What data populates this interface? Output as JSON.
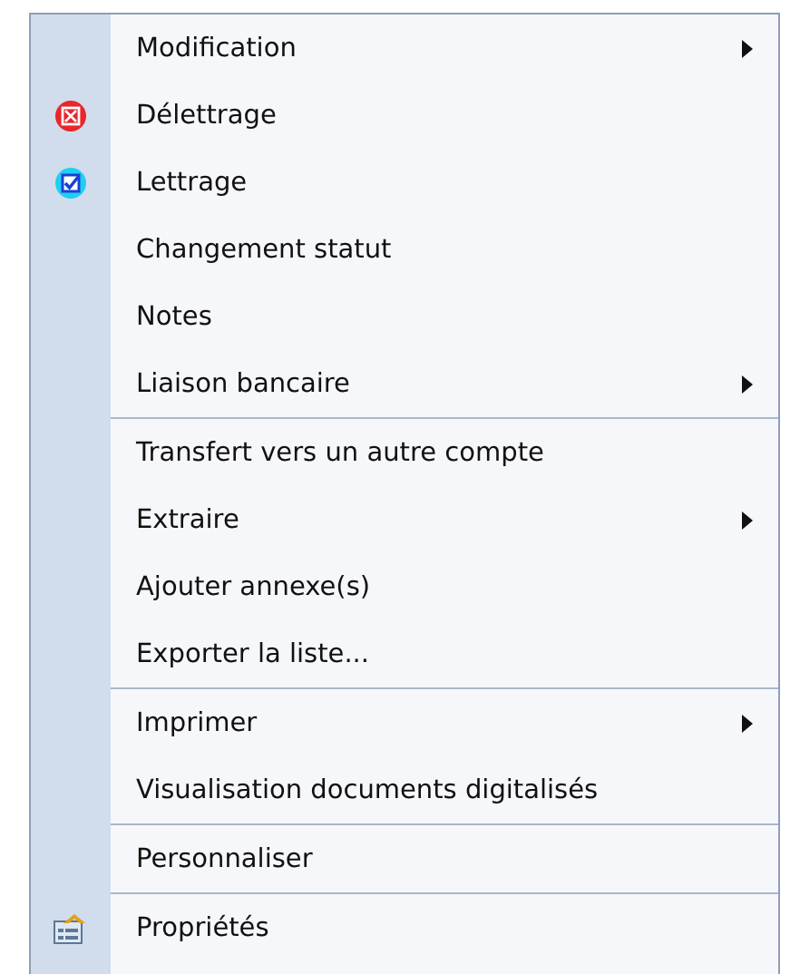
{
  "context_menu": {
    "sections": [
      {
        "items": [
          {
            "label": "Modification",
            "submenu": true
          },
          {
            "label": "Délettrage",
            "submenu": false
          },
          {
            "label": "Lettrage",
            "submenu": false
          },
          {
            "label": "Changement statut",
            "submenu": false
          },
          {
            "label": "Notes",
            "submenu": false
          },
          {
            "label": "Liaison bancaire",
            "submenu": true
          }
        ]
      },
      {
        "items": [
          {
            "label": "Transfert vers un autre compte",
            "submenu": false
          },
          {
            "label": "Extraire",
            "submenu": true
          },
          {
            "label": "Ajouter annexe(s)",
            "submenu": false
          },
          {
            "label": "Exporter la liste...",
            "submenu": false
          }
        ]
      },
      {
        "items": [
          {
            "label": "Imprimer",
            "submenu": true
          },
          {
            "label": "Visualisation documents digitalisés",
            "submenu": false
          }
        ]
      },
      {
        "items": [
          {
            "label": "Personnaliser",
            "submenu": false
          }
        ]
      },
      {
        "items": [
          {
            "label": "Propriétés",
            "submenu": false
          }
        ]
      }
    ]
  }
}
